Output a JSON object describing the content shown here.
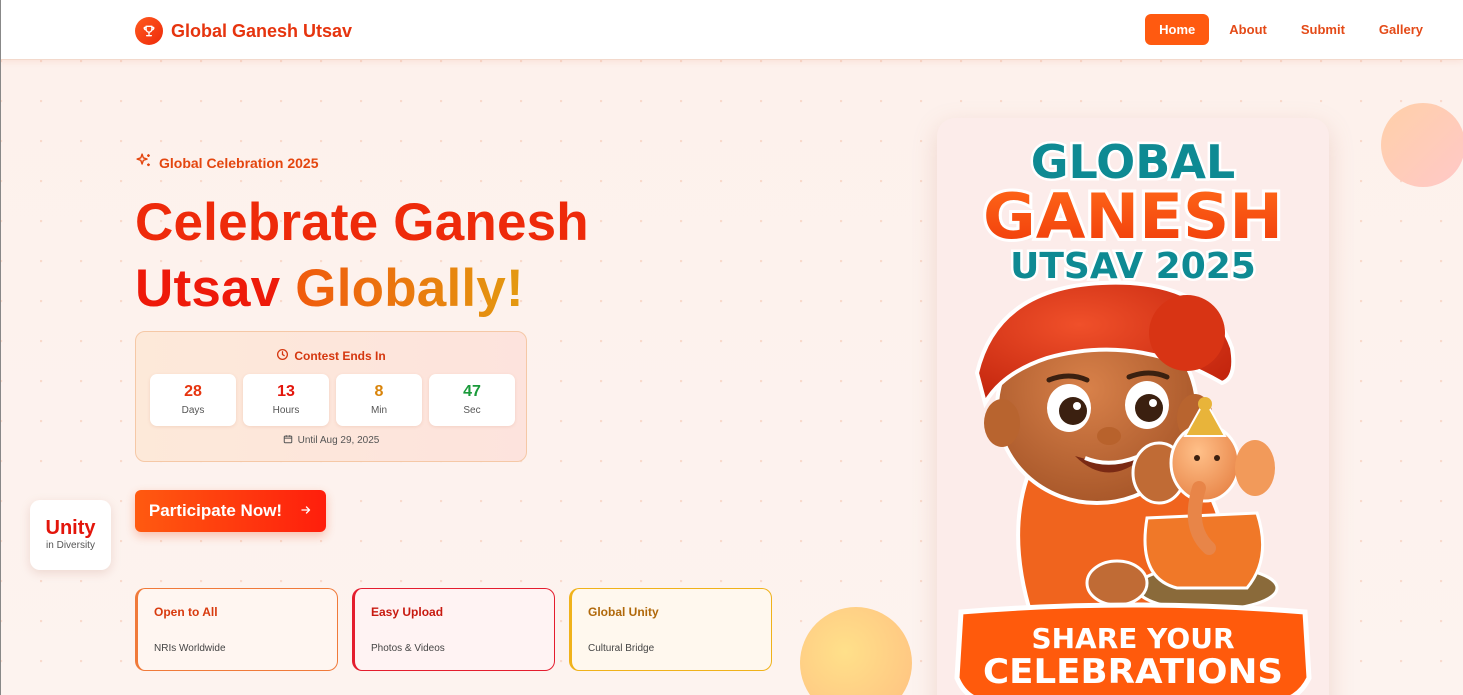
{
  "header": {
    "brand_name": "Global Ganesh Utsav",
    "nav": [
      {
        "label": "Home",
        "active": true
      },
      {
        "label": "About",
        "active": false
      },
      {
        "label": "Submit",
        "active": false
      },
      {
        "label": "Gallery",
        "active": false
      }
    ]
  },
  "hero": {
    "badge": "Global Celebration 2025",
    "title_line1": "Celebrate Ganesh",
    "title_line2_a": "Utsav ",
    "title_line2_b": "Globally!",
    "countdown": {
      "title": "Contest Ends In",
      "items": [
        {
          "value": "28",
          "unit": "Days",
          "color": "#e6340e"
        },
        {
          "value": "13",
          "unit": "Hours",
          "color": "#e3150b"
        },
        {
          "value": "8",
          "unit": "Min",
          "color": "#d9840a"
        },
        {
          "value": "47",
          "unit": "Sec",
          "color": "#1a9a3a"
        }
      ],
      "until": "Until Aug 29, 2025"
    },
    "cta_label": "Participate Now!"
  },
  "unity_card": {
    "big": "Unity",
    "small": "in Diversity"
  },
  "features": [
    {
      "title": "Open to All",
      "subtitle": "NRIs Worldwide"
    },
    {
      "title": "Easy Upload",
      "subtitle": "Photos & Videos"
    },
    {
      "title": "Global Unity",
      "subtitle": "Cultural Bridge"
    }
  ],
  "poster": {
    "line1": "GLOBAL",
    "line2": "GANESH",
    "line3": "UTSAV 2025",
    "banner_line1": "SHARE YOUR",
    "banner_line2": "CELEBRATIONS"
  },
  "colors": {
    "accent": "#ff5a10",
    "brand_red": "#ee2a0a",
    "teal": "#0e8a93"
  },
  "icons": [
    "trophy-icon",
    "sparkles-icon",
    "clock-icon",
    "calendar-icon",
    "arrow-right-icon"
  ]
}
